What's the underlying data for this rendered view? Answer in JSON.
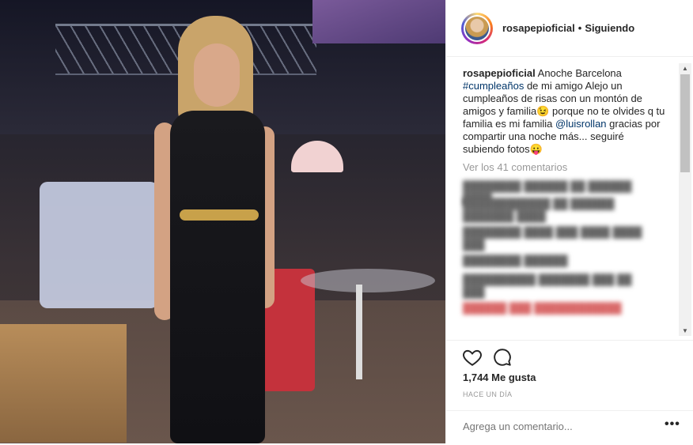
{
  "header": {
    "username": "rosapepioficial",
    "separator": "•",
    "follow_status": "Siguiendo"
  },
  "caption": {
    "username": "rosapepioficial",
    "text_1": "Anoche Barcelona",
    "hashtag": "#cumpleaños",
    "text_2": " de mi amigo Alejo un cumpleaños de risas con un montón de amigos y familia",
    "emoji_1": "😉",
    "text_3": " porque no te olvides q tu familia es mi familia ",
    "mention": "@luisrollan",
    "text_4": " gracias por compartir una noche más... seguiré subiendo fotos",
    "emoji_2": "😛"
  },
  "view_all_comments": "Ver los 41 comentarios",
  "likes": "1,744 Me gusta",
  "time_ago": "HACE UN DÍA",
  "add_comment_placeholder": "Agrega un comentario...",
  "more_options": "•••",
  "scroll": {
    "up": "▲",
    "down": "▼"
  },
  "colors": {
    "link": "#003569",
    "muted": "#999999",
    "border": "#efefef"
  }
}
